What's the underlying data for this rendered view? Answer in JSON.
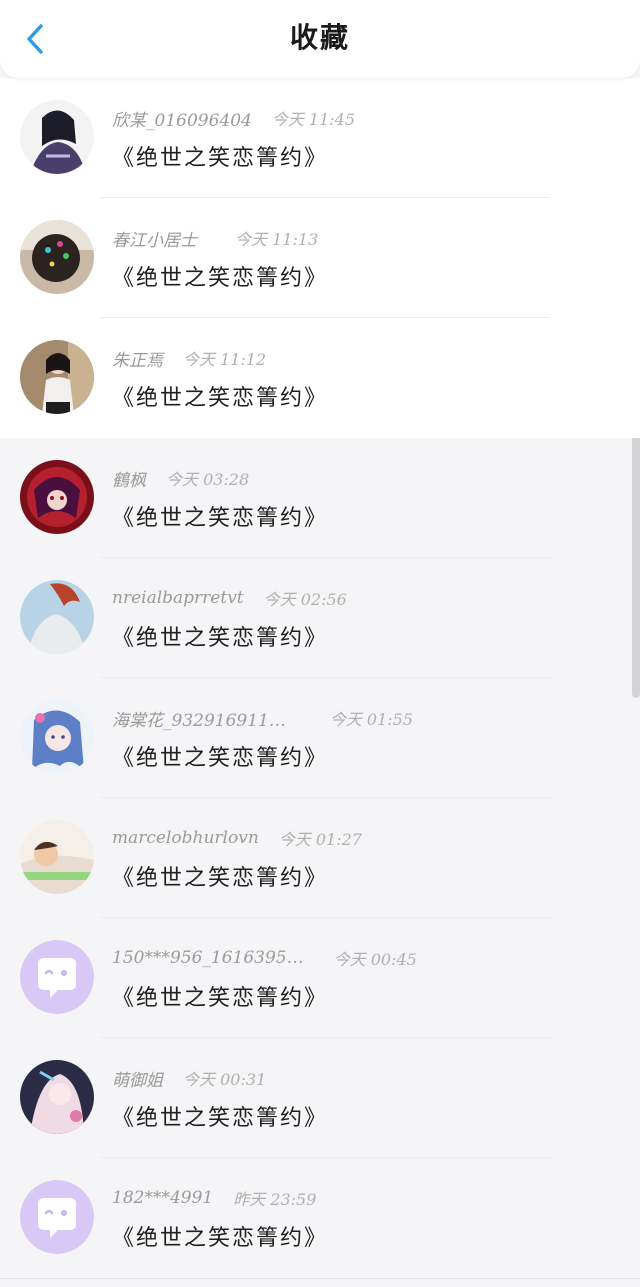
{
  "header": {
    "title": "收藏"
  },
  "favorites": [
    {
      "name": "欣某_016096404",
      "time": "今天 11:45",
      "content": "《绝世之笑恋箐约》",
      "avatar": "girl-illustration-avatar"
    },
    {
      "name": "春江小居士",
      "time": "今天 11:13",
      "content": "《绝世之笑恋箐约》",
      "avatar": "hair-flowers-photo-avatar"
    },
    {
      "name": "朱正焉",
      "time": "今天 11:12",
      "content": "《绝世之笑恋箐约》",
      "avatar": "girl-photo-avatar"
    },
    {
      "name": "鶴枫",
      "time": "今天 03:28",
      "content": "《绝世之笑恋箐约》",
      "avatar": "red-anime-avatar"
    },
    {
      "name": "nreialbaprretvt",
      "time": "今天 02:56",
      "content": "《绝世之笑恋箐约》",
      "avatar": "red-hair-back-avatar"
    },
    {
      "name": "海棠花_932916911…",
      "time": "今天 01:55",
      "content": "《绝世之笑恋箐约》",
      "avatar": "blue-hair-anime-avatar"
    },
    {
      "name": "marcelobhurlovn",
      "time": "今天 01:27",
      "content": "《绝世之笑恋箐约》",
      "avatar": "sleeping-child-avatar"
    },
    {
      "name": "150***956_1616395…",
      "time": "今天 00:45",
      "content": "《绝世之笑恋箐约》",
      "avatar": "chat-bubble-default-avatar"
    },
    {
      "name": "萌御姐",
      "time": "今天 00:31",
      "content": "《绝世之笑恋箐约》",
      "avatar": "pink-anime-avatar"
    },
    {
      "name": "182***4991",
      "time": "昨天 23:59",
      "content": "《绝世之笑恋箐约》",
      "avatar": "chat-bubble-default-avatar"
    }
  ],
  "colors": {
    "accent": "#2f9bea",
    "default_avatar": "#d7c8f6"
  }
}
